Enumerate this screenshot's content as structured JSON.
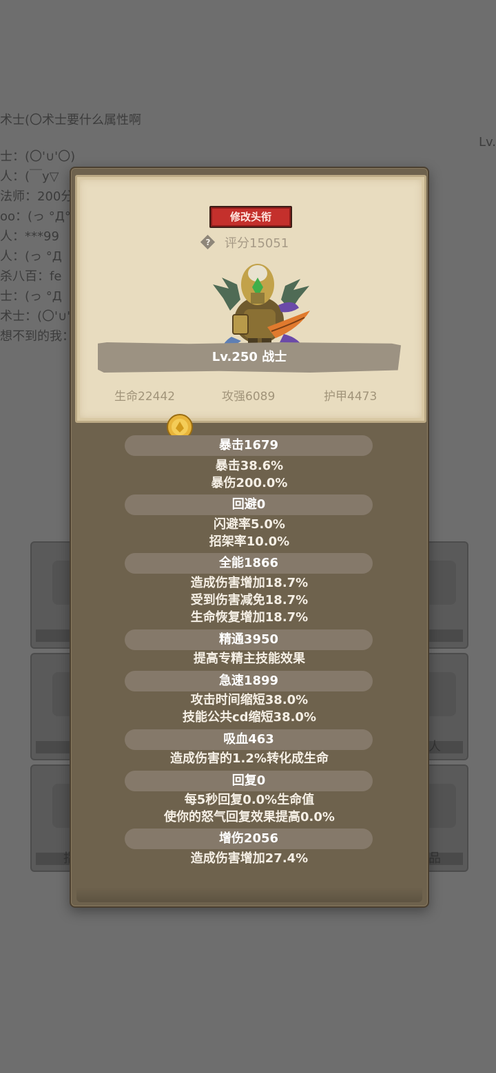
{
  "background": {
    "chat_lines": [
      "术士(〇术士要什么属性啊",
      "士：(〇'∪'〇)",
      "人：(￣y▽",
      "法师：200分",
      "oo：(っ °Д°",
      "人：***99",
      "人：(っ °Д",
      "杀八百：fe",
      "士：(っ °Д",
      "术士：(〇'∪'",
      "想不到的我："
    ],
    "lv_text": "Lv.",
    "card_texts": [
      "人",
      "指",
      "品"
    ]
  },
  "popup": {
    "title_button": "修改头衔",
    "score": "评分15051",
    "help_icon_glyph": "?",
    "hero_name": "Lv.250 战士",
    "base_stats": {
      "life": "生命22442",
      "attack": "攻强6089",
      "armor": "护甲4473"
    },
    "sections": [
      {
        "head": "暴击1679",
        "lines": [
          "暴击38.6%",
          "暴伤200.0%"
        ]
      },
      {
        "head": "回避0",
        "lines": [
          "闪避率5.0%",
          "招架率10.0%"
        ]
      },
      {
        "head": "全能1866",
        "lines": [
          "造成伤害增加18.7%",
          "受到伤害减免18.7%",
          "生命恢复增加18.7%"
        ]
      },
      {
        "head": "精通3950",
        "lines": [
          "提高专精主技能效果"
        ]
      },
      {
        "head": "急速1899",
        "lines": [
          "攻击时间缩短38.0%",
          "技能公共cd缩短38.0%"
        ]
      },
      {
        "head": "吸血463",
        "lines": [
          "造成伤害的1.2%转化成生命"
        ]
      },
      {
        "head": "回复0",
        "lines": [
          "每5秒回复0.0%生命值",
          "使你的怒气回复效果提高0.0%"
        ]
      },
      {
        "head": "增伤2056",
        "lines": [
          "造成伤害增加27.4%"
        ]
      }
    ]
  },
  "colors": {
    "title_button": "#c4302c",
    "parchment": "#e8dcbf",
    "panel": "#6e624d",
    "coin": "#e8b43a"
  }
}
